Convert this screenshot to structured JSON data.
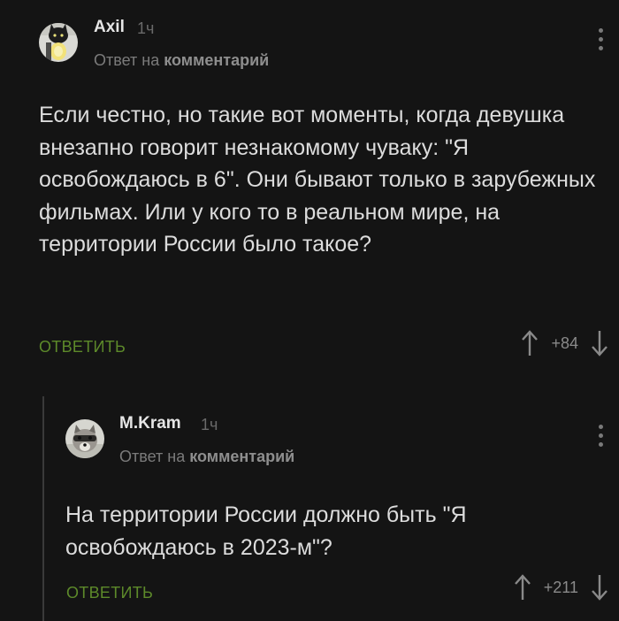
{
  "comments": [
    {
      "author": "Axil",
      "time": "1ч",
      "reply_prefix": "Ответ на",
      "reply_target": "комментарий",
      "text": "Если честно, но такие вот моменты, когда девушка внезапно говорит незнакомому чуваку: \"Я освобождаюсь в 6\". Они бывают только в зарубежных фильмах. Или у кого то в реальном мире, на территории России было такое?",
      "reply_label": "ОТВЕТИТЬ",
      "score": "+84"
    },
    {
      "author": "M.Kram",
      "time": "1ч",
      "reply_prefix": "Ответ на",
      "reply_target": "комментарий",
      "text": "На территории России должно быть \"Я освобождаюсь в 2023-м\"?",
      "reply_label": "ОТВЕТИТЬ",
      "score": "+211"
    }
  ],
  "colors": {
    "background": "#141414",
    "accent": "#5d8a2a"
  }
}
